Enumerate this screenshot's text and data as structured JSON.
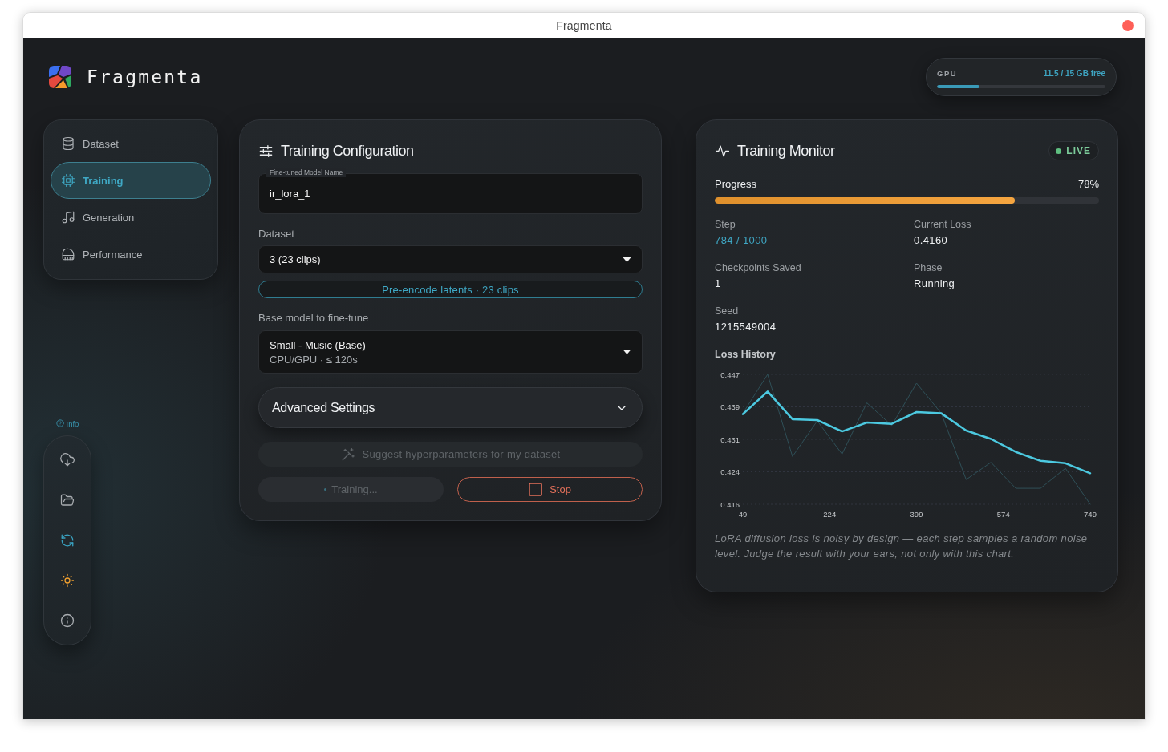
{
  "window": {
    "title": "Fragmenta"
  },
  "app": {
    "name": "Fragmenta"
  },
  "gpu": {
    "label": "GPU",
    "reading": "11.5 / 15 GB free",
    "level": 0.25
  },
  "sidebar": {
    "items": [
      {
        "label": "Dataset",
        "selected": false
      },
      {
        "label": "Training",
        "selected": true
      },
      {
        "label": "Generation",
        "selected": false
      },
      {
        "label": "Performance",
        "selected": false
      }
    ]
  },
  "info_link": {
    "label": "Info"
  },
  "config": {
    "title": "Training Configuration",
    "model_name": {
      "label": "Fine-tuned Model Name",
      "value": "ir_lora_1"
    },
    "dataset": {
      "label": "Dataset",
      "value": "3 (23 clips)"
    },
    "preencode_button": {
      "label": "Pre-encode latents · 23 clips"
    },
    "base_model": {
      "label": "Base model to fine-tune",
      "value": "Small - Music (Base)",
      "detail": "CPU/GPU · ≤ 120s"
    },
    "advanced": {
      "label": "Advanced Settings",
      "expanded": false
    },
    "suggest_button": {
      "label": "Suggest hyperparameters for my dataset",
      "disabled": true
    },
    "train_button": {
      "label": "Training...",
      "disabled": true,
      "busy": true
    },
    "stop_button": {
      "label": "Stop",
      "disabled": false
    }
  },
  "monitor": {
    "title": "Training Monitor",
    "live_badge": {
      "label": "LIVE",
      "on": true
    },
    "progress": {
      "label": "Progress",
      "reading": "78%",
      "level": 0.78
    },
    "stats": [
      {
        "label": "Step",
        "value": "784 / 1000",
        "highlight": true
      },
      {
        "label": "Current Loss",
        "value": "0.4160",
        "highlight": false
      },
      {
        "label": "Checkpoints Saved",
        "value": "1",
        "highlight": false
      },
      {
        "label": "Phase",
        "value": "Running",
        "highlight": false
      },
      {
        "label": "Seed",
        "value": "1215549004",
        "highlight": false
      }
    ],
    "loss_history": {
      "title": "Loss History",
      "chart_data": {
        "type": "line",
        "x": [
          49,
          99,
          149,
          199,
          249,
          299,
          349,
          399,
          449,
          499,
          549,
          599,
          649,
          699,
          749
        ],
        "series": [
          {
            "color": "#2f5058",
            "values": [
              0.4377,
              0.447,
              0.4274,
              0.4359,
              0.428,
              0.4402,
              0.4348,
              0.4449,
              0.4377,
              0.4219,
              0.426,
              0.4198,
              0.4198,
              0.4246,
              0.416
            ]
          },
          {
            "color": "#4cc9e0",
            "values": [
              0.4375,
              0.4429,
              0.4363,
              0.4361,
              0.4334,
              0.4355,
              0.4352,
              0.438,
              0.4377,
              0.4336,
              0.4316,
              0.4285,
              0.4264,
              0.4258,
              0.4234
            ]
          }
        ],
        "xlim": [
          49,
          749
        ],
        "ylim": [
          0.416,
          0.447
        ],
        "xticks": [
          49,
          224,
          399,
          574,
          749
        ],
        "yticks": [
          {
            "value": 0.416,
            "label": "0.416"
          },
          {
            "value": 0.42375,
            "label": "0.424"
          },
          {
            "value": 0.4315,
            "label": "0.431"
          },
          {
            "value": 0.43925,
            "label": "0.439"
          },
          {
            "value": 0.447,
            "label": "0.447"
          }
        ],
        "grid": "y"
      }
    },
    "note": "LoRA diffusion loss is noisy by design — each step samples a random noise level. Judge the result with your ears, not only with this chart."
  }
}
